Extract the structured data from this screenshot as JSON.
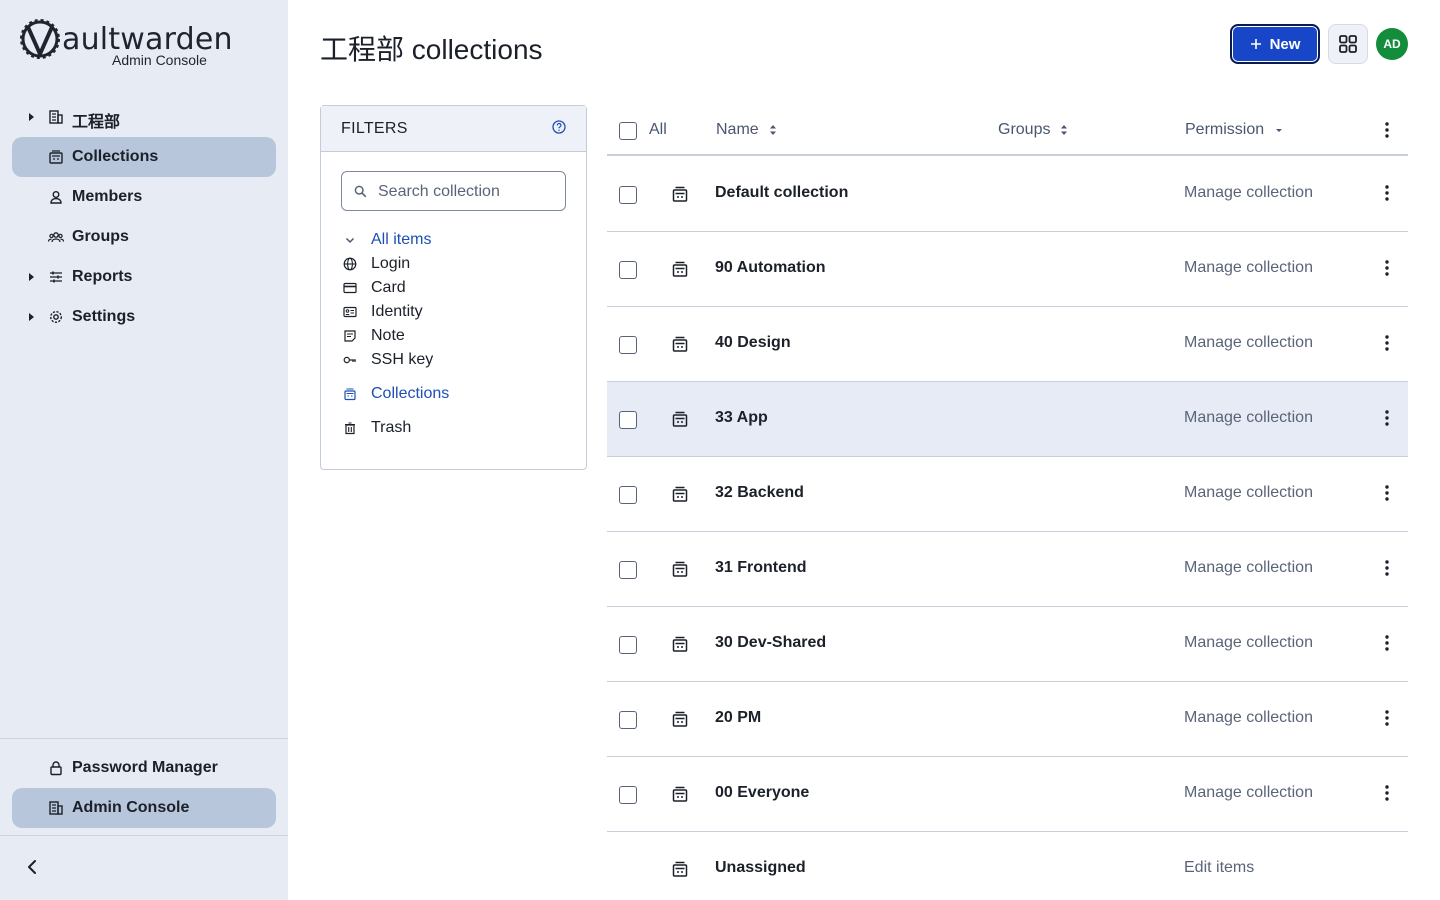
{
  "sidebar": {
    "logo": {
      "word": "aultwarden",
      "sub": "Admin Console"
    },
    "items": [
      {
        "label": "工程部",
        "icon": "org-icon",
        "expandable": true,
        "active": false
      },
      {
        "label": "Collections",
        "icon": "collection-icon",
        "expandable": false,
        "active": true
      },
      {
        "label": "Members",
        "icon": "user-icon",
        "expandable": false,
        "active": false
      },
      {
        "label": "Groups",
        "icon": "users-icon",
        "expandable": false,
        "active": false
      },
      {
        "label": "Reports",
        "icon": "sliders-icon",
        "expandable": true,
        "active": false
      },
      {
        "label": "Settings",
        "icon": "gear-icon",
        "expandable": true,
        "active": false
      }
    ],
    "bottom": [
      {
        "label": "Password Manager",
        "icon": "lock-icon",
        "active": false
      },
      {
        "label": "Admin Console",
        "icon": "org-icon",
        "active": true
      }
    ]
  },
  "header": {
    "title": "工程部 collections",
    "new_label": "New",
    "avatar_initials": "AD",
    "avatar_color": "#138d3b",
    "accent": "#1746c9"
  },
  "filters": {
    "title": "FILTERS",
    "search_placeholder": "Search collection",
    "all_items": "All items",
    "types": [
      {
        "label": "Login",
        "icon": "globe-icon"
      },
      {
        "label": "Card",
        "icon": "card-icon"
      },
      {
        "label": "Identity",
        "icon": "id-card-icon"
      },
      {
        "label": "Note",
        "icon": "note-icon"
      },
      {
        "label": "SSH key",
        "icon": "key-icon"
      }
    ],
    "collections": "Collections",
    "trash": "Trash"
  },
  "table": {
    "headers": {
      "all": "All",
      "name": "Name",
      "groups": "Groups",
      "permission": "Permission"
    },
    "rows": [
      {
        "name": "Default collection",
        "permission": "Manage collection",
        "checkbox": true,
        "highlight": false
      },
      {
        "name": "90 Automation",
        "permission": "Manage collection",
        "checkbox": true,
        "highlight": false
      },
      {
        "name": "40 Design",
        "permission": "Manage collection",
        "checkbox": true,
        "highlight": false
      },
      {
        "name": "33 App",
        "permission": "Manage collection",
        "checkbox": true,
        "highlight": true
      },
      {
        "name": "32 Backend",
        "permission": "Manage collection",
        "checkbox": true,
        "highlight": false
      },
      {
        "name": "31 Frontend",
        "permission": "Manage collection",
        "checkbox": true,
        "highlight": false
      },
      {
        "name": "30 Dev-Shared",
        "permission": "Manage collection",
        "checkbox": true,
        "highlight": false
      },
      {
        "name": "20 PM",
        "permission": "Manage collection",
        "checkbox": true,
        "highlight": false
      },
      {
        "name": "00 Everyone",
        "permission": "Manage collection",
        "checkbox": true,
        "highlight": false
      },
      {
        "name": "Unassigned",
        "permission": "Edit items",
        "checkbox": false,
        "highlight": false
      }
    ]
  }
}
